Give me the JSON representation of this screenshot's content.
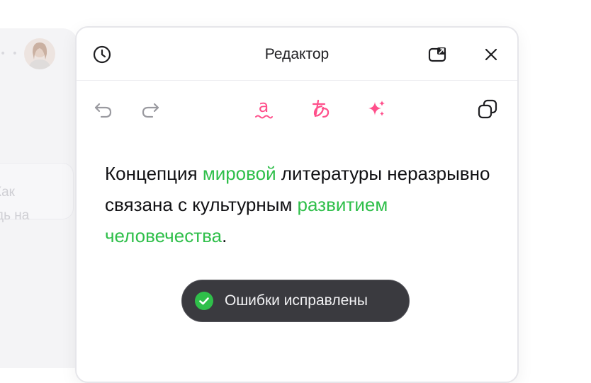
{
  "background_app": {
    "card_text_line1": "Как",
    "card_text_line2": "дь на"
  },
  "editor": {
    "title": "Редактор",
    "header_icons": [
      "history-icon",
      "open-external-icon",
      "close-icon"
    ],
    "toolbar_icons": [
      "undo-icon",
      "redo-icon",
      "spellcheck-icon",
      "translate-icon",
      "sparkle-icon",
      "copy-icon"
    ],
    "text": {
      "part1": "Концепция ",
      "highlight1": "мировой",
      "part2": " литературы неразрывно связана с культурным ",
      "highlight2": "развитием человечества",
      "part3": "."
    },
    "colors": {
      "highlight": "#2fbf4a",
      "accent_pink": "#ff4f8b",
      "toast_bg": "#3a3a3f",
      "success": "#2fbf4a"
    }
  },
  "toast": {
    "message": "Ошибки исправлены",
    "icon": "check-circle-icon"
  }
}
